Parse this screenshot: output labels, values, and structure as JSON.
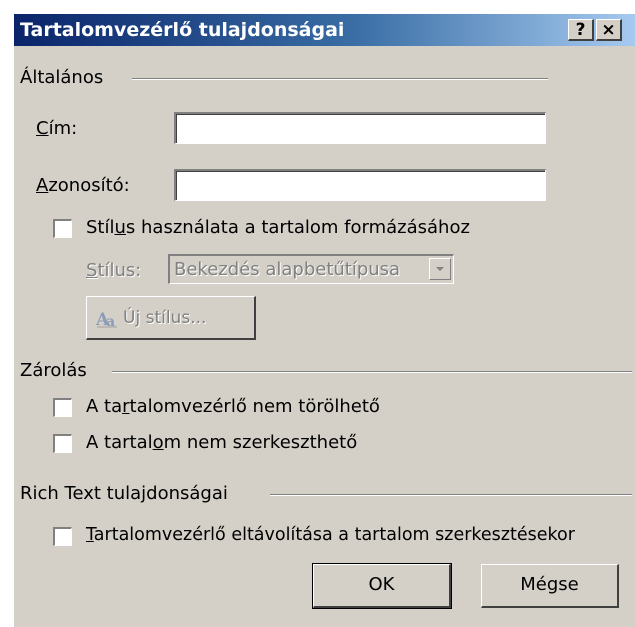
{
  "window": {
    "title": "Tartalomvezérlő tulajdonságai",
    "help_label": "?",
    "close_label": "×"
  },
  "general": {
    "group_label": "Általános",
    "title_label_pre": "",
    "title_label_ul": "C",
    "title_label_post": "ím:",
    "title_value": "",
    "tag_label_pre": "",
    "tag_label_ul": "A",
    "tag_label_post": "zonosító:",
    "tag_value": "",
    "use_style_pre": "Stíl",
    "use_style_ul": "u",
    "use_style_post": "s használata a tartalom formázásához",
    "use_style_checked": false,
    "style_label_pre": "",
    "style_label_ul": "S",
    "style_label_post": "tílus:",
    "style_value": "Bekezdés alapbetűtípusa",
    "new_style_pre": "Ú",
    "new_style_ul": "j",
    "new_style_post": " stílus..."
  },
  "locking": {
    "group_label": "Zárolás",
    "no_delete_pre": "A ta",
    "no_delete_ul": "r",
    "no_delete_post": "talomvezérlő nem törölhető",
    "no_delete_checked": false,
    "no_edit_pre": "A tartal",
    "no_edit_ul": "o",
    "no_edit_post": "m nem szerkeszthető",
    "no_edit_checked": false
  },
  "rich_text": {
    "group_label": "Rich Text tulajdonságai",
    "remove_pre": "",
    "remove_ul": "T",
    "remove_post": "artalomvezérlő eltávolítása a tartalom szerkesztésekor",
    "remove_checked": false
  },
  "buttons": {
    "ok": "OK",
    "cancel": "Mégse"
  }
}
